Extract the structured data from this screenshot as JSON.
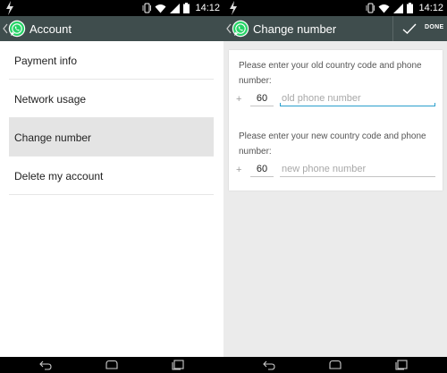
{
  "status_bar": {
    "time": "14:12"
  },
  "left_screen": {
    "title": "Account",
    "menu": [
      {
        "label": "Payment info"
      },
      {
        "label": "Network usage"
      },
      {
        "label": "Change number"
      },
      {
        "label": "Delete my account"
      }
    ],
    "selected_index": 2
  },
  "right_screen": {
    "title": "Change number",
    "done_label": "DONE",
    "old": {
      "prompt": "Please enter your old country code and phone number:",
      "plus": "+",
      "country_code": "60",
      "placeholder": "old phone number"
    },
    "new": {
      "prompt": "Please enter your new country code and phone number:",
      "plus": "+",
      "country_code": "60",
      "placeholder": "new phone number"
    }
  },
  "colors": {
    "action_bar": "#3f4d4d",
    "whatsapp_green": "#25d366",
    "selected_row": "#e4e4e4",
    "focus_underline": "#2a9fcc"
  },
  "icons": [
    "flash-icon",
    "vibrate-icon",
    "wifi-icon",
    "signal-icon",
    "battery-icon",
    "back-chevron-icon",
    "whatsapp-logo-icon",
    "check-icon",
    "nav-back-icon",
    "nav-home-icon",
    "nav-recents-icon"
  ]
}
